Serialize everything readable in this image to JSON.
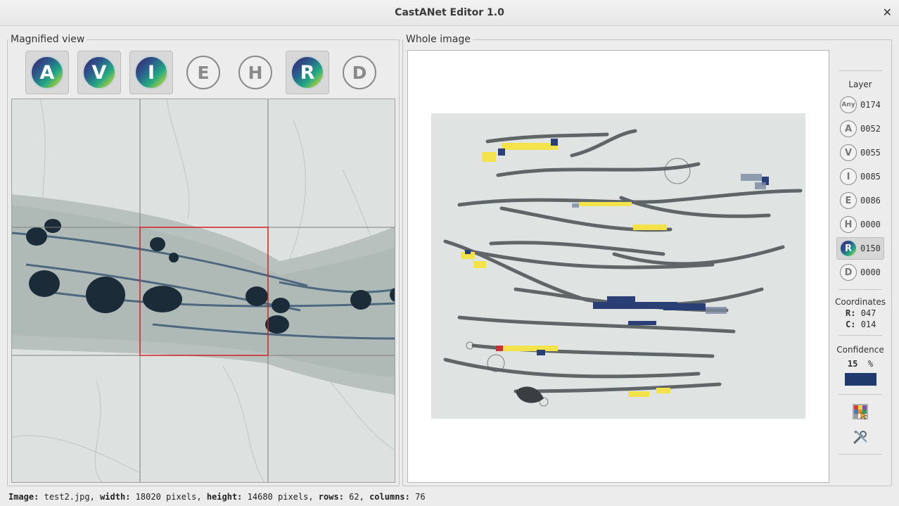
{
  "window": {
    "title": "CastANet Editor 1.0",
    "close_glyph": "✕"
  },
  "magnified": {
    "legend": "Magnified view",
    "buttons": [
      {
        "letter": "A",
        "style": "viridis",
        "active": true
      },
      {
        "letter": "V",
        "style": "viridis",
        "active": true
      },
      {
        "letter": "I",
        "style": "viridis",
        "active": true
      },
      {
        "letter": "E",
        "style": "outline",
        "active": false
      },
      {
        "letter": "H",
        "style": "outline",
        "active": false
      },
      {
        "letter": "R",
        "style": "viridis",
        "active": true
      },
      {
        "letter": "D",
        "style": "outline",
        "active": false
      }
    ]
  },
  "whole": {
    "legend": "Whole image"
  },
  "sidebar": {
    "layer_title": "Layer",
    "layers": [
      {
        "icon": "Any",
        "count": "0174",
        "active": false
      },
      {
        "icon": "A",
        "count": "0052",
        "active": false
      },
      {
        "icon": "V",
        "count": "0055",
        "active": false
      },
      {
        "icon": "I",
        "count": "0085",
        "active": false
      },
      {
        "icon": "E",
        "count": "0086",
        "active": false
      },
      {
        "icon": "H",
        "count": "0000",
        "active": false
      },
      {
        "icon": "R",
        "count": "0150",
        "active": true
      },
      {
        "icon": "D",
        "count": "0000",
        "active": false
      }
    ],
    "coordinates_title": "Coordinates",
    "row_label": "R:",
    "row_value": "047",
    "col_label": "C:",
    "col_value": "014",
    "confidence_title": "Confidence",
    "confidence_value": "15",
    "confidence_unit": "%",
    "confidence_color": "#213a6d",
    "tools": [
      "heatmap-palette-icon",
      "settings-tools-icon"
    ]
  },
  "status": {
    "image_label": "Image:",
    "image_value": "test2.jpg,",
    "width_label": "width:",
    "width_value": "18020 pixels,",
    "height_label": "height:",
    "height_value": "14680 pixels,",
    "rows_label": "rows:",
    "rows_value": "62,",
    "columns_label": "columns:",
    "columns_value": "76"
  }
}
